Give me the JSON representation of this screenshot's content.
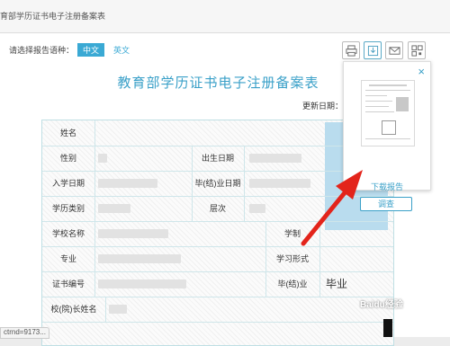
{
  "tab": {
    "title": "育部学历证书电子注册备案表"
  },
  "lang": {
    "label": "请选择报告语种：",
    "zh": "中文",
    "en": "英文"
  },
  "toolbar": {
    "icons": [
      "print-icon",
      "download-icon",
      "mail-icon",
      "qrcode-icon"
    ]
  },
  "doc": {
    "title": "教育部学历证书电子注册备案表",
    "update_label": "更新日期：2"
  },
  "table": {
    "name": "姓名",
    "gender": "性别",
    "birth": "出生日期",
    "enroll": "入学日期",
    "graduate": "毕(结)业日期",
    "level": "学历类别",
    "tier": "层次",
    "school": "学校名称",
    "duration": "学制",
    "major": "专业",
    "study_form": "学习形式",
    "cert_no": "证书编号",
    "grad_status": "毕(结)业",
    "grad_value": "毕业",
    "president": "校(院)长姓名"
  },
  "popup": {
    "close": "×",
    "download": "下载报告",
    "query": "调查"
  },
  "status": {
    "text": "ctrnd=9173..."
  },
  "watermark": {
    "text": "Baidu经验"
  },
  "colors": {
    "accent": "#3aa0c8",
    "arrow": "#e3241b"
  }
}
